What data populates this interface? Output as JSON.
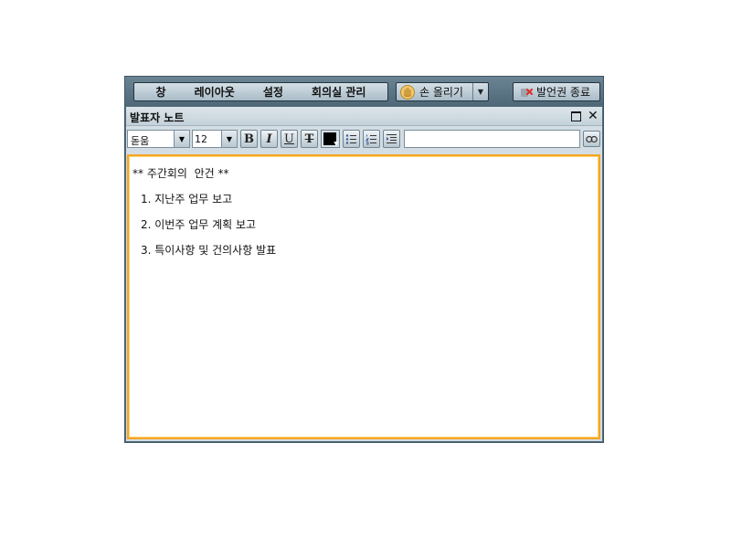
{
  "menubar": {
    "items": [
      "창",
      "레이아웃",
      "설정",
      "회의실 관리"
    ],
    "raise_hand_label": "손 올리기",
    "end_speaking_label": "발언권 종료"
  },
  "panel": {
    "title": "발표자 노트",
    "toolbar": {
      "font_family": "돋움",
      "font_size": "12",
      "bold_label": "B",
      "italic_label": "I",
      "underline_label": "U",
      "strike_label": "T",
      "text_color": "#000000",
      "link_input_value": ""
    },
    "content": [
      "** 주간회의  안건 **",
      "1. 지난주 업무 보고",
      "2. 이번주 업무 계획 보고",
      "3. 특이사항 및 건의사항 발표"
    ]
  },
  "colors": {
    "frame": "#516c7c",
    "panel_bg": "#d3dde3",
    "editor_focus_border": "#f5a623"
  }
}
